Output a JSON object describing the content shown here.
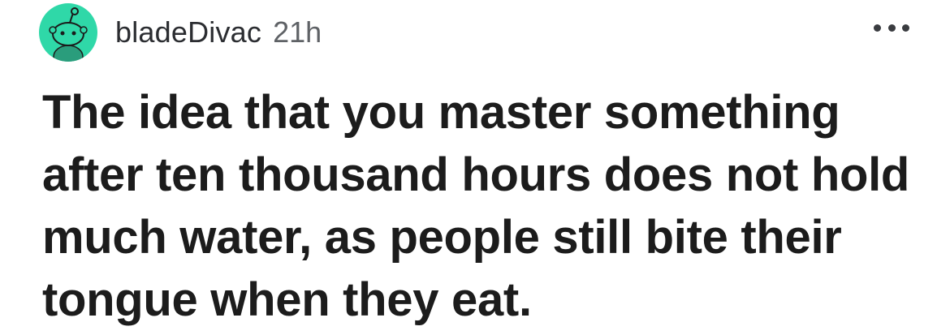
{
  "post": {
    "author": "bladeDivac",
    "age": "21h",
    "avatar_icon": "reddit-snoo-avatar-icon",
    "more_icon": "more-options-icon",
    "text": "The idea that you master something after ten thousand hours does not hold much water, as people still bite their tongue when they eat."
  },
  "colors": {
    "avatar_bg": "#2fd8a8",
    "text": "#1c1c1c",
    "meta": "#5f6266"
  }
}
